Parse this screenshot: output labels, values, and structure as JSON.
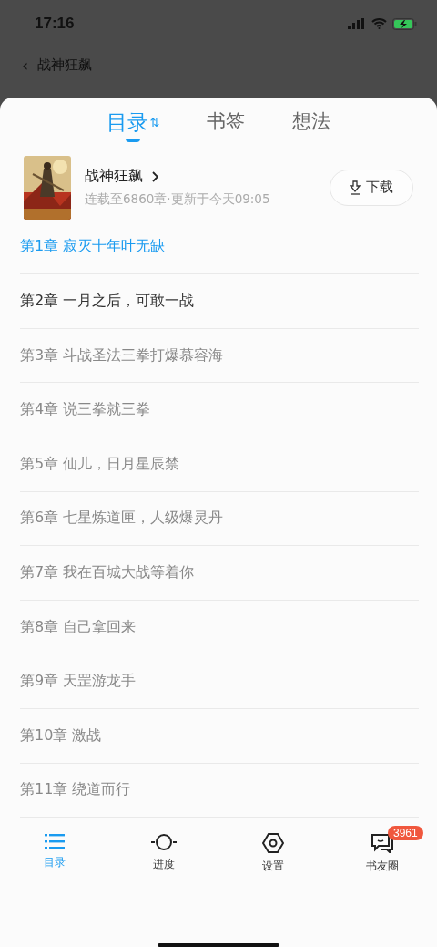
{
  "status_bar": {
    "time": "17:16"
  },
  "nav_bar": {
    "back_icon": "‹",
    "title": "战神狂飙"
  },
  "tabs": [
    {
      "label": "目录",
      "selected": true,
      "sort_icon": "⇅"
    },
    {
      "label": "书签",
      "selected": false
    },
    {
      "label": "想法",
      "selected": false
    }
  ],
  "book": {
    "title": "战神狂飙",
    "subtitle": "连载至6860章·更新于今天09:05",
    "download_button": "下载"
  },
  "chapters": [
    {
      "title": "第1章 寂灭十年叶无缺",
      "selected": true,
      "dimmed": false
    },
    {
      "title": "第2章 一月之后，可敢一战",
      "selected": false,
      "dimmed": false
    },
    {
      "title": "第3章 斗战圣法三拳打爆慕容海",
      "selected": false,
      "dimmed": true
    },
    {
      "title": "第4章 说三拳就三拳",
      "selected": false,
      "dimmed": true
    },
    {
      "title": "第5章 仙儿，日月星辰禁",
      "selected": false,
      "dimmed": true
    },
    {
      "title": "第6章 七星炼道匣，人级爆灵丹",
      "selected": false,
      "dimmed": true
    },
    {
      "title": "第7章 我在百城大战等着你",
      "selected": false,
      "dimmed": true
    },
    {
      "title": "第8章 自己拿回来",
      "selected": false,
      "dimmed": true
    },
    {
      "title": "第9章 天罡游龙手",
      "selected": false,
      "dimmed": true
    },
    {
      "title": "第10章 激战",
      "selected": false,
      "dimmed": true
    },
    {
      "title": "第11章 绕道而行",
      "selected": false,
      "dimmed": true
    }
  ],
  "bottom_nav": [
    {
      "kind": "list",
      "label": "目录",
      "selected": true
    },
    {
      "kind": "progress",
      "label": "进度",
      "selected": false
    },
    {
      "kind": "settings",
      "label": "设置",
      "selected": false
    },
    {
      "kind": "chat",
      "label": "书友圈",
      "selected": false,
      "badge": "3961"
    }
  ]
}
